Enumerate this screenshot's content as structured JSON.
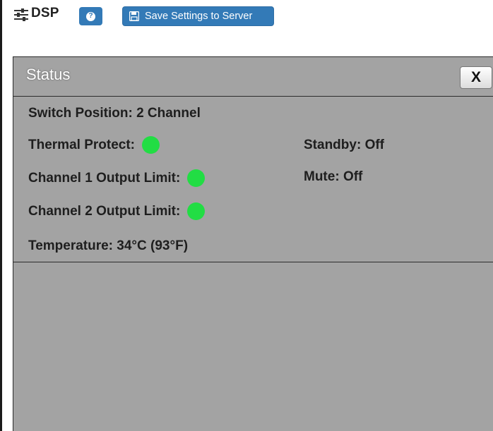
{
  "header": {
    "title": "DSP",
    "help_label": "?",
    "save_label": "Save Settings to Server"
  },
  "status_panel": {
    "title": "Status",
    "close_label": "X",
    "switch_position": {
      "label": "Switch Position:",
      "value": "2 Channel"
    },
    "thermal_protect": {
      "label": "Thermal Protect:",
      "led_color": "#22dd44"
    },
    "channel1_output_limit": {
      "label": "Channel 1 Output Limit:",
      "led_color": "#22dd44"
    },
    "channel2_output_limit": {
      "label": "Channel 2 Output Limit:",
      "led_color": "#22dd44"
    },
    "temperature": {
      "label": "Temperature:",
      "value": "34°C (93°F)"
    },
    "standby": {
      "label": "Standby:",
      "value": "Off"
    },
    "mute": {
      "label": "Mute:",
      "value": "Off"
    }
  },
  "colors": {
    "accent": "#337ab7",
    "panel_bg": "#a3a3a3",
    "led_on": "#22dd44"
  }
}
